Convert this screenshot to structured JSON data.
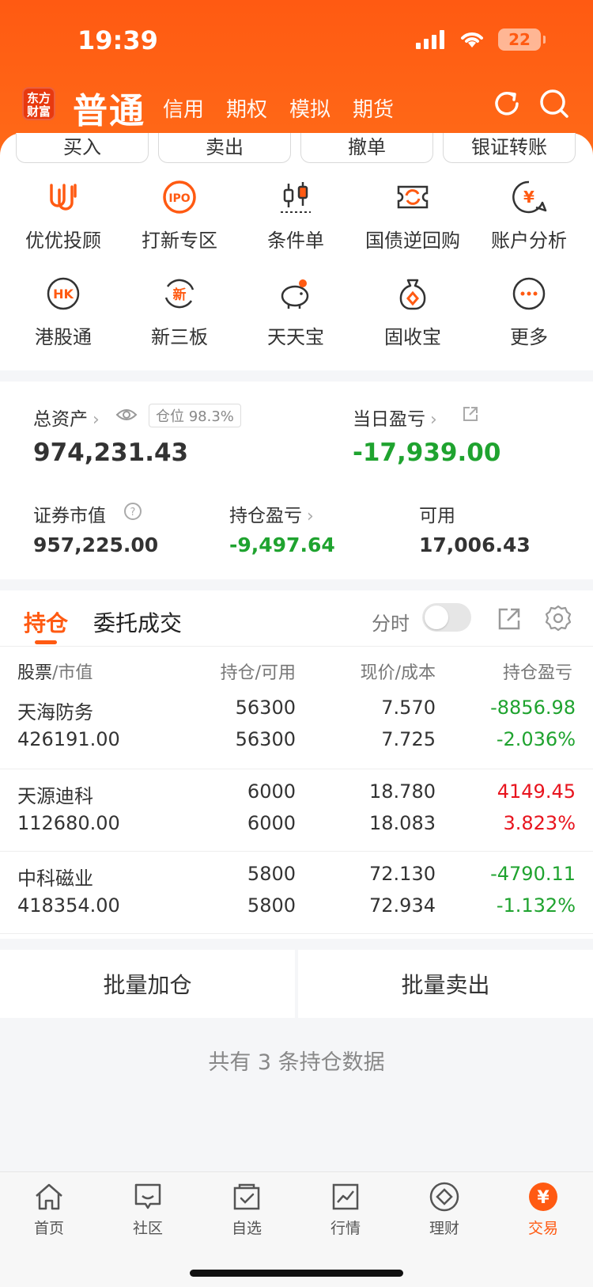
{
  "status": {
    "time": "19:39",
    "battery": "22"
  },
  "header": {
    "logo_text_1": "东方",
    "logo_text_2": "财富",
    "active_tab": "普通",
    "tabs": [
      "信用",
      "期权",
      "模拟",
      "期货"
    ],
    "icons": [
      "refresh-icon",
      "search-icon"
    ]
  },
  "actions": [
    "买入",
    "卖出",
    "撤单",
    "银证转账"
  ],
  "grid": [
    {
      "label": "优优投顾",
      "icon": "youyou-icon"
    },
    {
      "label": "打新专区",
      "icon": "ipo-icon"
    },
    {
      "label": "条件单",
      "icon": "candlestick-icon"
    },
    {
      "label": "国债逆回购",
      "icon": "repo-icon"
    },
    {
      "label": "账户分析",
      "icon": "yuan-chat-icon"
    },
    {
      "label": "港股通",
      "icon": "hk-icon"
    },
    {
      "label": "新三板",
      "icon": "new-board-icon"
    },
    {
      "label": "天天宝",
      "icon": "piggy-bank-icon"
    },
    {
      "label": "固收宝",
      "icon": "money-bag-icon"
    },
    {
      "label": "更多",
      "icon": "more-icon"
    }
  ],
  "assets": {
    "total_label": "总资产",
    "position_ratio": "仓位 98.3%",
    "total_value": "974,231.43",
    "daily_pl_label": "当日盈亏",
    "daily_pl_value": "-17,939.00",
    "market_value_label": "证券市值",
    "market_value": "957,225.00",
    "holding_pl_label": "持仓盈亏",
    "holding_pl_value": "-9,497.64",
    "available_label": "可用",
    "available_value": "17,006.43"
  },
  "holdings": {
    "tabs": [
      "持仓",
      "委托成交"
    ],
    "timeshare_label": "分时",
    "headers": {
      "stock": "股票",
      "stock_sub": "/市值",
      "qty": "持仓",
      "qty_sub": "/可用",
      "price": "现价",
      "price_sub": "/成本",
      "pl": "持仓盈亏"
    },
    "rows": [
      {
        "name": "天海防务",
        "value": "426191.00",
        "qty": "56300",
        "avail": "56300",
        "price": "7.570",
        "cost": "7.725",
        "pl": "-8856.98",
        "pct": "-2.036%",
        "dir": "down"
      },
      {
        "name": "天源迪科",
        "value": "112680.00",
        "qty": "6000",
        "avail": "6000",
        "price": "18.780",
        "cost": "18.083",
        "pl": "4149.45",
        "pct": "3.823%",
        "dir": "up"
      },
      {
        "name": "中科磁业",
        "value": "418354.00",
        "qty": "5800",
        "avail": "5800",
        "price": "72.130",
        "cost": "72.934",
        "pl": "-4790.11",
        "pct": "-1.132%",
        "dir": "down"
      }
    ],
    "bulk_add": "批量加仓",
    "bulk_sell": "批量卖出",
    "total_text": "共有 3 条持仓数据"
  },
  "tabbar": [
    {
      "label": "首页",
      "icon": "home-icon"
    },
    {
      "label": "社区",
      "icon": "community-icon"
    },
    {
      "label": "自选",
      "icon": "watchlist-icon"
    },
    {
      "label": "行情",
      "icon": "market-icon"
    },
    {
      "label": "理财",
      "icon": "wealth-icon"
    },
    {
      "label": "交易",
      "icon": "trade-icon",
      "active": true
    }
  ],
  "colors": {
    "brand": "#ff5a12",
    "up": "#e8141e",
    "down": "#1fa32f"
  }
}
